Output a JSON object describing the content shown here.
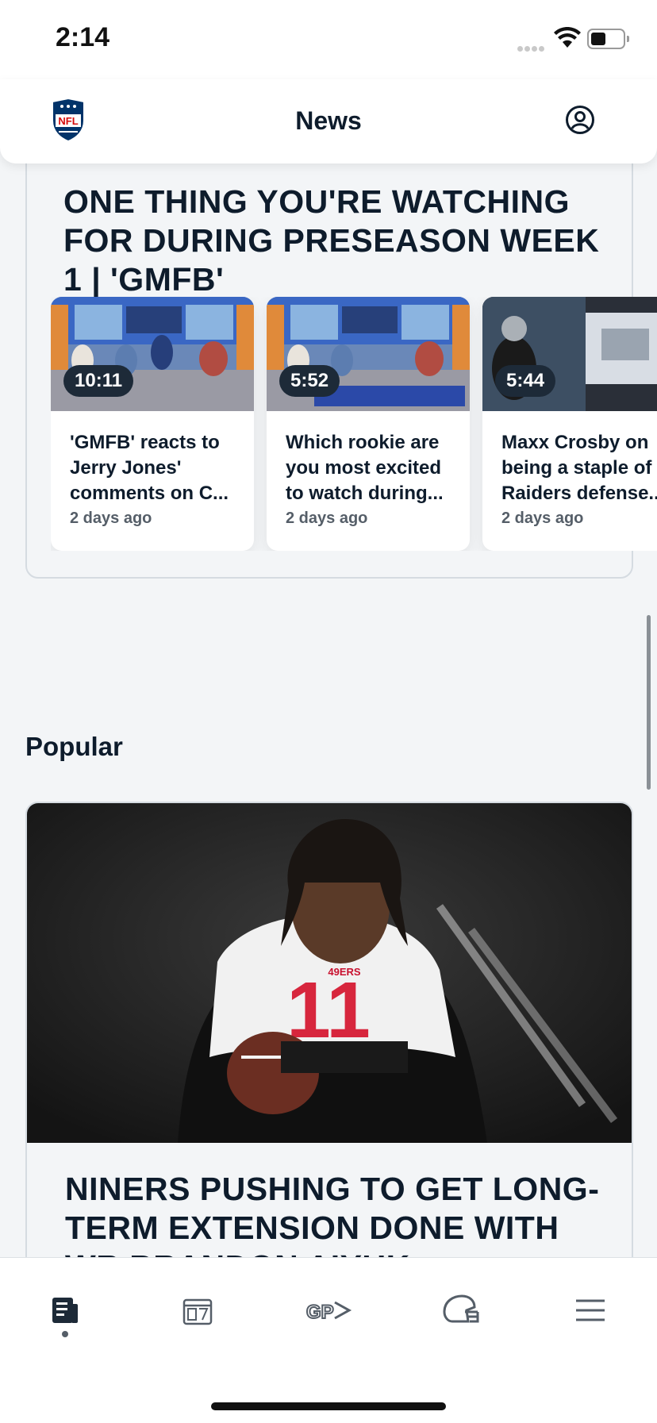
{
  "status_bar": {
    "time": "2:14"
  },
  "header": {
    "title": "News",
    "logo_icon": "nfl-shield-logo",
    "account_icon": "account-icon"
  },
  "video_section": {
    "headline": "ONE THING YOU'RE WATCHING FOR DURING PRESEASON WEEK 1 | 'GMFB'",
    "videos": [
      {
        "duration": "10:11",
        "title": "'GMFB' reacts to Jerry Jones' comments on C...",
        "age": "2 days ago"
      },
      {
        "duration": "5:52",
        "title": "Which rookie are you most excited to watch during...",
        "age": "2 days ago"
      },
      {
        "duration": "5:44",
        "title": "Maxx Crosby on being a staple of Raiders defense...",
        "age": "2 days ago"
      }
    ]
  },
  "popular": {
    "label": "Popular",
    "story_headline": "NINERS PUSHING TO GET LONG-TERM EXTENSION DONE WITH WR BRANDON AIYUK"
  },
  "tabbar": {
    "tabs": [
      {
        "name": "news",
        "icon": "news-icon"
      },
      {
        "name": "scores",
        "icon": "scores-icon"
      },
      {
        "name": "game-pass",
        "icon": "game-pass-icon"
      },
      {
        "name": "teams",
        "icon": "helmet-icon"
      },
      {
        "name": "more",
        "icon": "menu-icon"
      }
    ],
    "active": "news"
  },
  "colors": {
    "ink": "#0e1c2c",
    "background": "#f3f5f7",
    "nfl_blue": "#013369",
    "nfl_red": "#d50a0a"
  }
}
